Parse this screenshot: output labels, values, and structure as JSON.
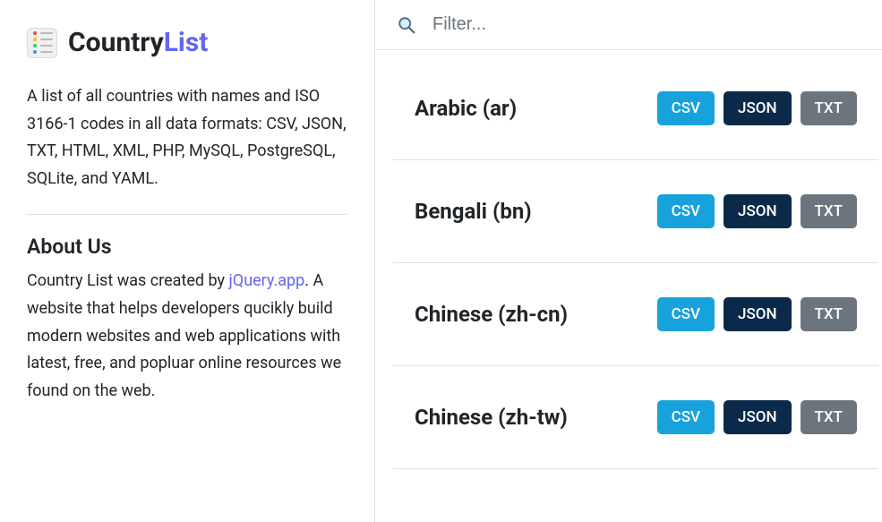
{
  "brand": {
    "title_part1": "Country",
    "title_part2": "List"
  },
  "sidebar": {
    "description": "A list of all countries with names and ISO 3166-1 codes in all data formats: CSV, JSON, TXT, HTML, XML, PHP, MySQL, PostgreSQL, SQLite, and YAML.",
    "about_heading": "About Us",
    "about_prefix": "Country List was created by ",
    "about_link_text": "jQuery.app",
    "about_suffix": ". A website that helps developers qucikly build modern websites and web applications with latest, free, and popluar online resources we found on the web."
  },
  "filter": {
    "placeholder": "Filter..."
  },
  "buttons": {
    "csv": "CSV",
    "json": "JSON",
    "txt": "TXT"
  },
  "languages": [
    {
      "label": "Arabic (ar)"
    },
    {
      "label": "Bengali (bn)"
    },
    {
      "label": "Chinese (zh-cn)"
    },
    {
      "label": "Chinese (zh-tw)"
    }
  ],
  "colors": {
    "accent_link": "#6366f1",
    "btn_csv": "#17a2dc",
    "btn_json": "#0b2a4a",
    "btn_txt": "#6c757d"
  }
}
